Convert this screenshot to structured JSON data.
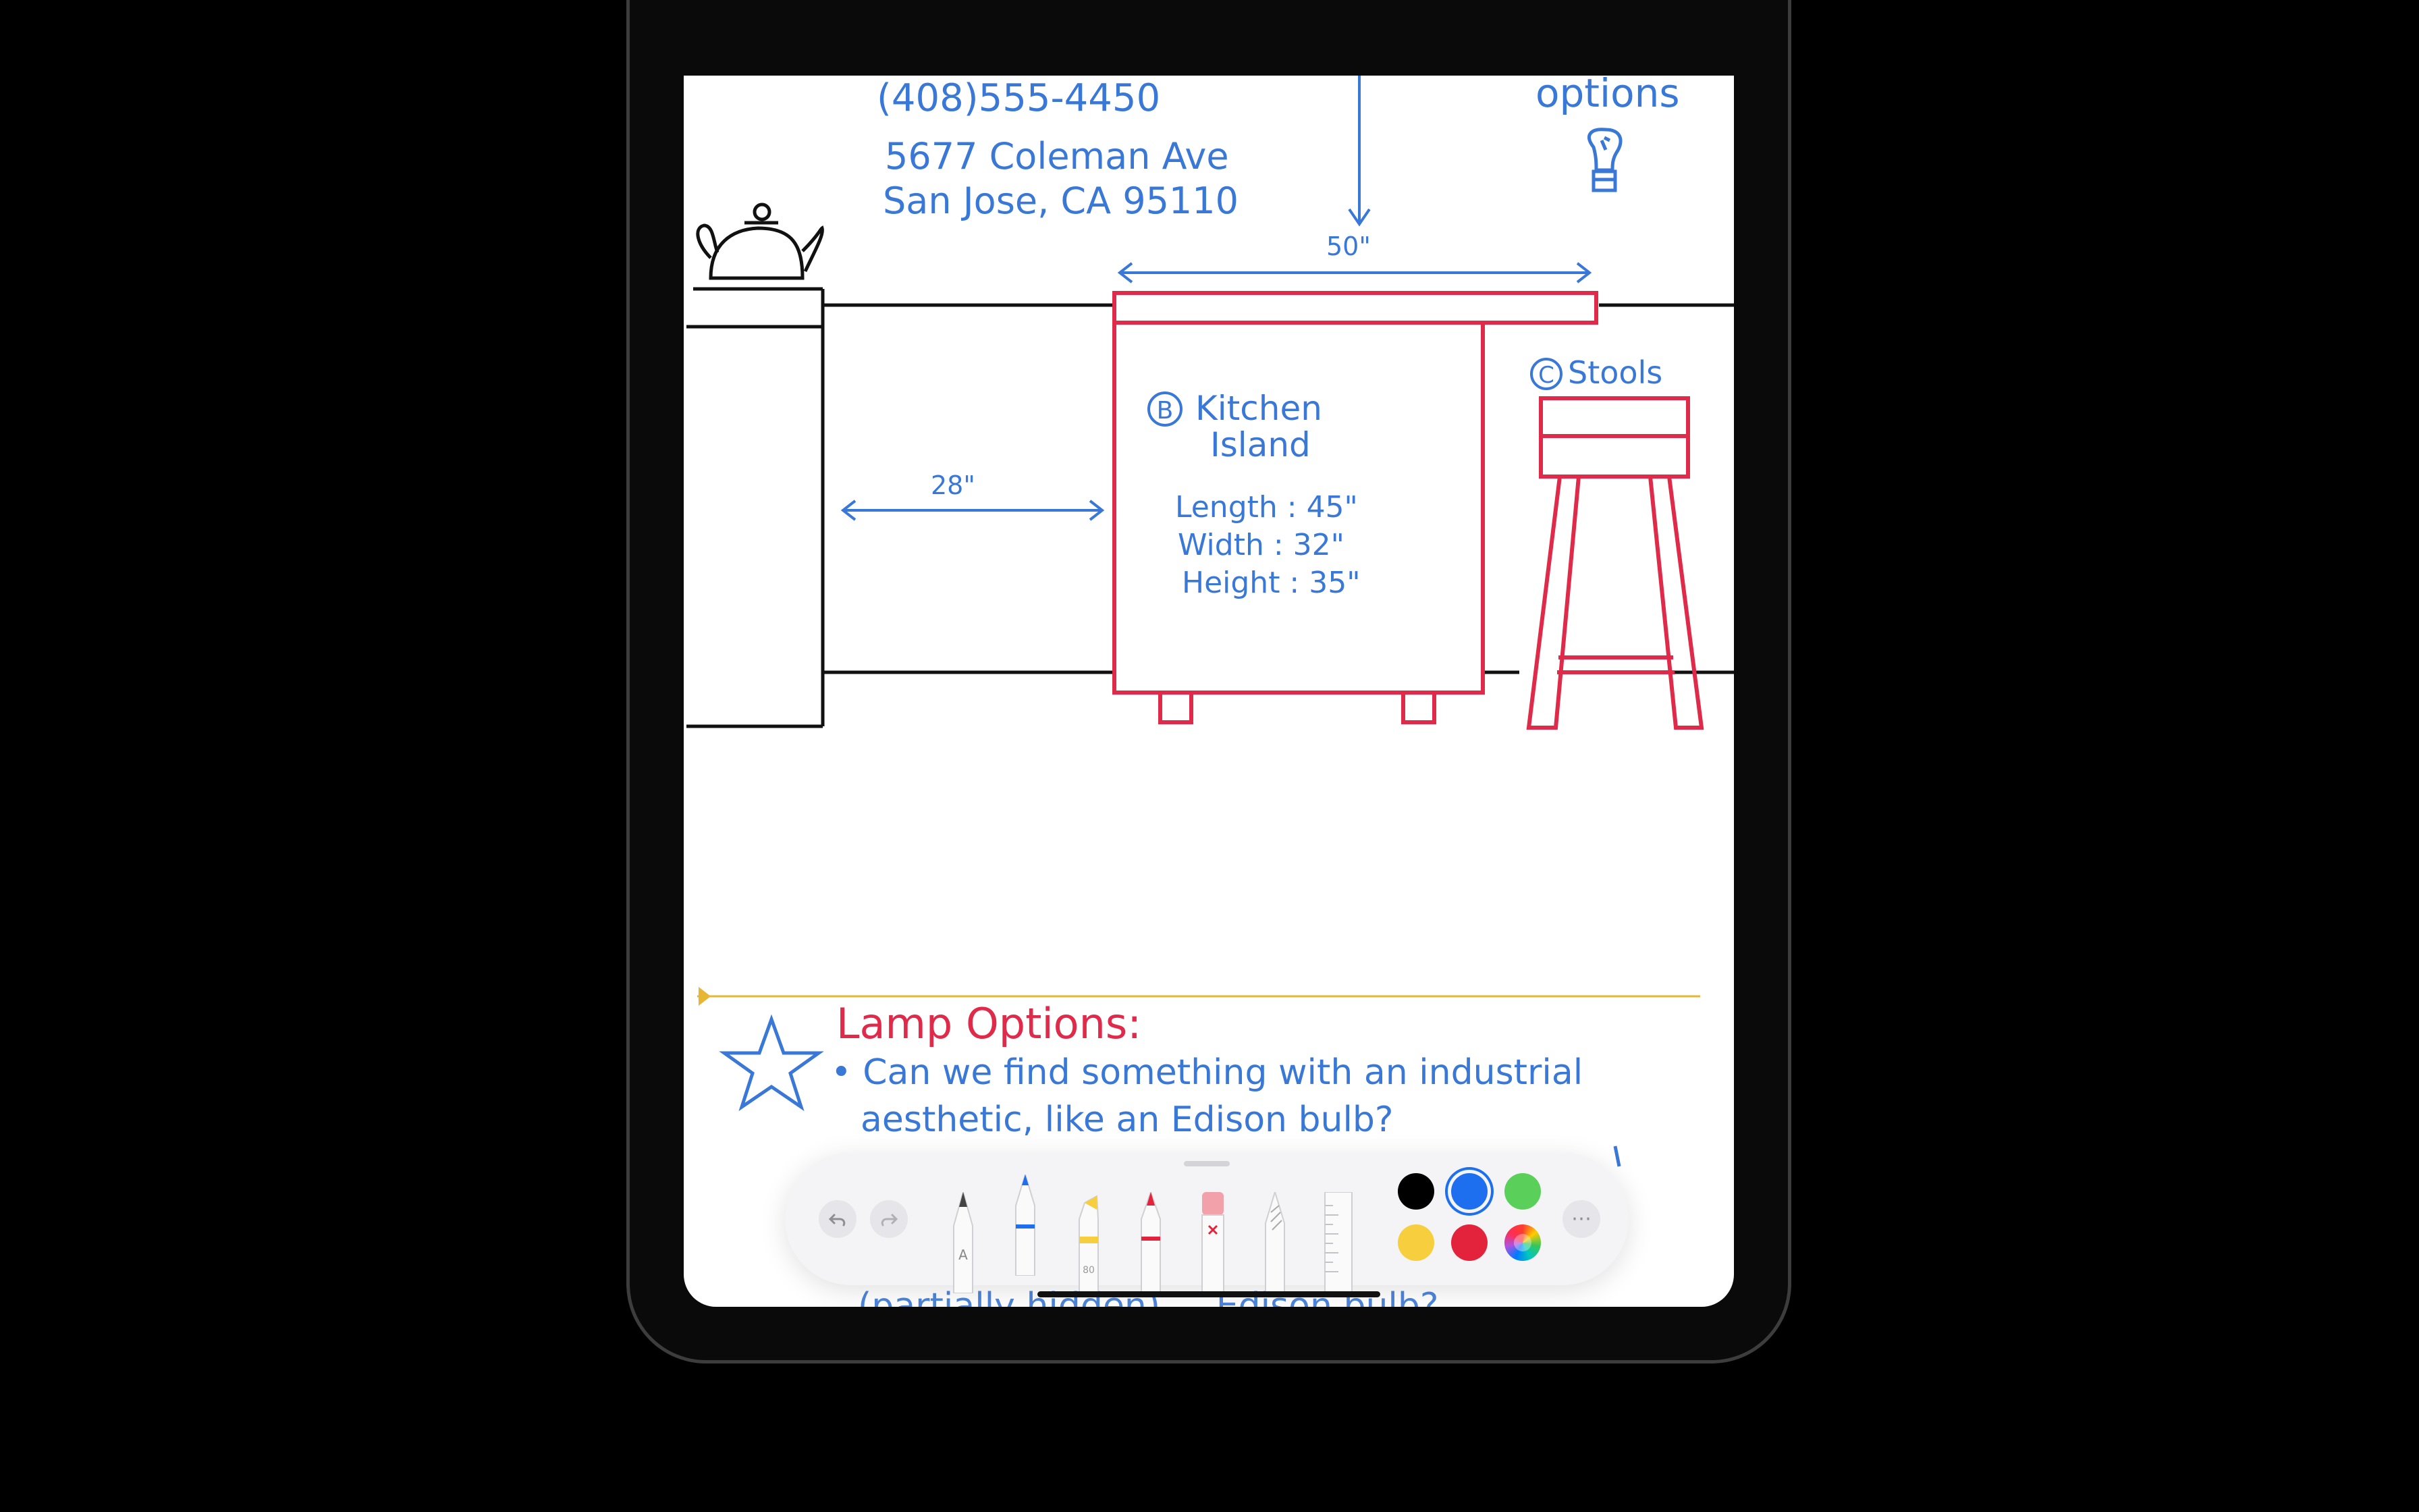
{
  "note": {
    "phone": "(408)555-4450",
    "address_line1": "5677 Coleman Ave",
    "address_line2": "San Jose, CA 95110",
    "options_label": "options",
    "dim_island_width": "50\"",
    "dim_clearance": "28\"",
    "island_marker": "B",
    "island_title_line1": "Kitchen",
    "island_title_line2": "Island",
    "island_length": "Length : 45\"",
    "island_width": "Width : 32\"",
    "island_height": "Height : 35\"",
    "stools_marker": "C",
    "stools_label": "Stools",
    "lamp_heading": "Lamp Options:",
    "bullet_line1": "• Can we find something with an industrial",
    "bullet_line2": "aesthetic, like an Edison bulb?",
    "cut_off_line": "(partially hidden) ... Edison bulb?"
  },
  "palette": {
    "undo_icon": "undo-icon",
    "redo_icon": "redo-icon",
    "tools": [
      "pencil",
      "pen",
      "marker",
      "crayon",
      "eraser",
      "fountain-pen",
      "ruler"
    ],
    "swatches": [
      {
        "name": "black",
        "color": "#000000",
        "selected": false
      },
      {
        "name": "blue",
        "color": "#1e6ff0",
        "selected": true
      },
      {
        "name": "green",
        "color": "#5ad05a",
        "selected": false
      },
      {
        "name": "yellow",
        "color": "#f7ce3e",
        "selected": false
      },
      {
        "name": "red",
        "color": "#e3223b",
        "selected": false
      },
      {
        "name": "multicolor",
        "color": "conic",
        "selected": false
      }
    ],
    "more_icon": "ellipsis-icon"
  },
  "colors": {
    "ink_blue": "#3a78d8",
    "ink_red": "#e02a4a",
    "ink_black": "#111111",
    "divider_gold": "#e6b634"
  }
}
